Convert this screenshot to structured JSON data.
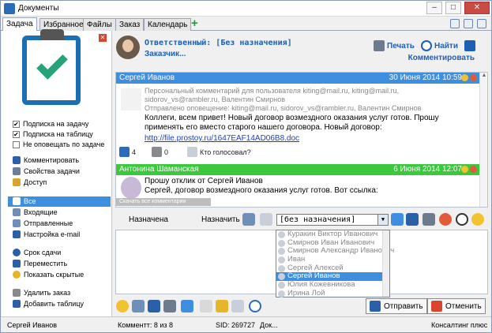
{
  "window": {
    "title": "Документы"
  },
  "tabs": [
    {
      "label": "Задача",
      "active": true
    },
    {
      "label": "Избранное"
    },
    {
      "label": "Файлы"
    },
    {
      "label": "Заказ"
    },
    {
      "label": "Календарь"
    }
  ],
  "tab_add": "+",
  "sidebar": {
    "checkboxes": [
      {
        "label": "Подписка на задачу",
        "checked": true
      },
      {
        "label": "Подписка на таблицу",
        "checked": true
      },
      {
        "label": "Не оповещать по задаче",
        "checked": false
      }
    ],
    "actions": [
      "Комментировать",
      "Свойства задачи",
      "Доступ"
    ],
    "filters": [
      "Все",
      "Входящие",
      "Отправленные",
      "Настройка e-mail"
    ],
    "more": [
      "Срок сдачи",
      "Переместить",
      "Показать скрытые"
    ],
    "bottom": [
      "Удалить заказ",
      "Добавить таблицу"
    ]
  },
  "header": {
    "responsible": "Ответственный: [Без назначения]",
    "customer": "Заказчик...",
    "print": "Печать",
    "find": "Найти",
    "comment": "Комментировать"
  },
  "feed": {
    "messages": [
      {
        "author": "Сергей Иванов",
        "date": "30 Июня 2014 10:59",
        "meta1": "Персональный комментарий для пользователя kiting@mail.ru,  kiting@mail.ru,",
        "meta2": "sidorov_vs@rambler.ru, Валентин Смирнов",
        "meta3": "Отправлено оповещение: kiting@mail.ru,  sidorov_vs@rambler.ru, Валентин Смирнов",
        "text1": "Коллеги, всем привет! Новый договор возмездного оказания услуг готов. Прошу",
        "text2": "применять его вместо старого нашего договора. Новый договор:",
        "link": "http://file.prostoy.ru/1647EAF14AD06B8.doc",
        "likes": "4",
        "dislikes": "0",
        "who_voted": "Кто голосовал?"
      },
      {
        "author": "Антонина Шаманская",
        "date": "6 Июня 2014 12:07",
        "text1": "Прошу отклик от Сергей Иванов",
        "text2": "Сергей, договор возмездного оказания услуг готов. Вот ссылка:"
      }
    ],
    "download_all": "Скачать все комментарии"
  },
  "assign": {
    "assigned_label": "Назначена",
    "assign_label": "Назначить",
    "combo_value": "[без назначения]"
  },
  "dropdown_options": [
    {
      "name": "Куракин Виктор Иванович",
      "selected": false
    },
    {
      "name": "Смирнов Иван Иванович",
      "selected": false
    },
    {
      "name": "Смирнов Александр Иванович",
      "selected": false
    },
    {
      "name": "Иван",
      "selected": false
    },
    {
      "name": "Сергей Алексей",
      "selected": false
    },
    {
      "name": "Сергей Иванов",
      "selected": true
    },
    {
      "name": "Юлия Кожевникова",
      "selected": false
    },
    {
      "name": "Ирина Лой",
      "selected": false
    }
  ],
  "buttons": {
    "send": "Отправить",
    "cancel": "Отменить"
  },
  "status": {
    "user": "Сергей Иванов",
    "comment_count": "Комментт: 8 из 8",
    "sid": "SID: 269727",
    "doc": "Док...",
    "product": "Консалтинг плюс"
  },
  "colors": {
    "accent": "#3e8fe0",
    "head_blue": "#3e8fe0",
    "head_green": "#3cc83c",
    "link": "#1b5fb6"
  }
}
